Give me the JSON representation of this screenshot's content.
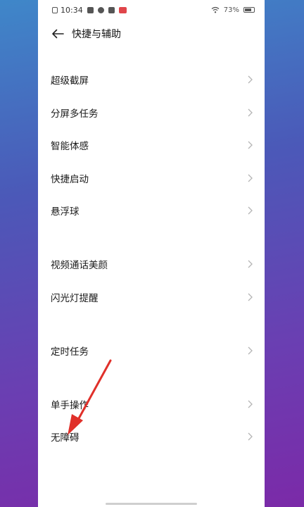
{
  "status_bar": {
    "time": "10:34",
    "battery": "73%",
    "battery_level": 0.73
  },
  "header": {
    "title": "快捷与辅助"
  },
  "items": [
    {
      "label": "超级截屏"
    },
    {
      "label": "分屏多任务"
    },
    {
      "label": "智能体感"
    },
    {
      "label": "快捷启动"
    },
    {
      "label": "悬浮球"
    },
    {
      "label": "视频通话美颜"
    },
    {
      "label": "闪光灯提醒"
    },
    {
      "label": "定时任务"
    },
    {
      "label": "单手操作"
    },
    {
      "label": "无障碍"
    }
  ],
  "colors": {
    "annotation_arrow": "#e0302a"
  }
}
